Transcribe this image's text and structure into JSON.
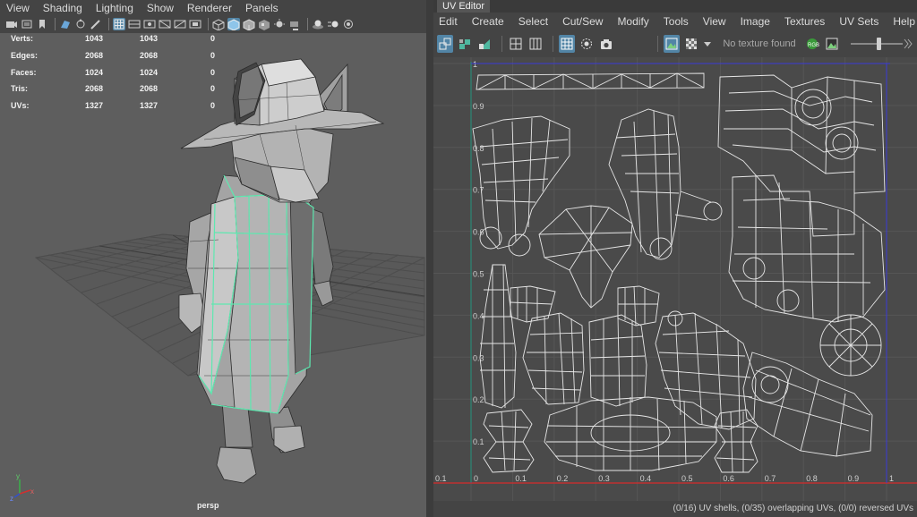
{
  "viewport": {
    "menu": [
      "View",
      "Shading",
      "Lighting",
      "Show",
      "Renderer",
      "Panels"
    ],
    "toolbar_icons": [
      "camera-icon",
      "camera-attributes-icon",
      "bookmark-icon",
      "image-plane-icon",
      "grease-pencil-icon",
      "2d-pan-icon",
      "grid-icon",
      "film-gate-icon",
      "resolution-gate-icon",
      "gate-mask-icon",
      "field-chart-icon",
      "safe-action-icon",
      "safe-title-icon",
      "wireframe-icon",
      "smooth-shade-icon",
      "wireframe-on-shaded-icon",
      "textured-icon",
      "use-all-lights-icon",
      "shadows-icon",
      "ambient-occlusion-icon",
      "motion-blur-icon",
      "anti-aliasing-icon"
    ],
    "hud": {
      "rows": [
        {
          "label": "Verts:",
          "v1": "1043",
          "v2": "1043",
          "v3": "0"
        },
        {
          "label": "Edges:",
          "v1": "2068",
          "v2": "2068",
          "v3": "0"
        },
        {
          "label": "Faces:",
          "v1": "1024",
          "v2": "1024",
          "v3": "0"
        },
        {
          "label": "Tris:",
          "v1": "2068",
          "v2": "2068",
          "v3": "0"
        },
        {
          "label": "UVs:",
          "v1": "1327",
          "v2": "1327",
          "v3": "0"
        }
      ]
    },
    "camera_label": "persp",
    "axis": {
      "x": "x",
      "y": "y",
      "z": "z"
    },
    "colors": {
      "background": "#5e5e5e",
      "grid": "#4d4d4d",
      "selection": "#5ee8b0",
      "model": "#9a9a9a"
    }
  },
  "uv_editor": {
    "tab_label": "UV Editor",
    "menu": [
      "Edit",
      "Create",
      "Select",
      "Cut/Sew",
      "Modify",
      "Tools",
      "View",
      "Image",
      "Textures",
      "UV Sets",
      "Help"
    ],
    "toolbar_icons": [
      "uv-shell-select-icon",
      "uv-component-icon",
      "uv-face-select-icon",
      "uv-grid-icon",
      "uv-snap-icon",
      "uv-toggle-grid-icon",
      "uv-shaded-icon",
      "uv-snapshot-icon",
      "texture-display-icon",
      "checker-icon",
      "dropdown-arrow-icon",
      "rgb-channel-icon",
      "image-display-icon"
    ],
    "texture_status": "No texture found",
    "exposure_slider": 0.55,
    "y_axis_labels": [
      "1",
      "0.9",
      "0.8",
      "0.7",
      "0.6",
      "0.5",
      "0.4",
      "0.3",
      "0.2",
      "0.1",
      "0"
    ],
    "x_axis_labels": [
      "0.1",
      "0",
      "0.1",
      "0.2",
      "0.3",
      "0.4",
      "0.5",
      "0.6",
      "0.7",
      "0.8",
      "0.9",
      "1"
    ],
    "status": "(0/16) UV shells, (0/35) overlapping UVs, (0/0) reversed UVs",
    "colors": {
      "grid_area": "#4a4a4a",
      "grid_line": "#565656",
      "uv_lines": "#e6e6e6",
      "u_axis": "#c03030",
      "v_axis": "#2c9a3a",
      "border_axis": "#3b3bd8",
      "active_icon": "#5285a6"
    }
  }
}
